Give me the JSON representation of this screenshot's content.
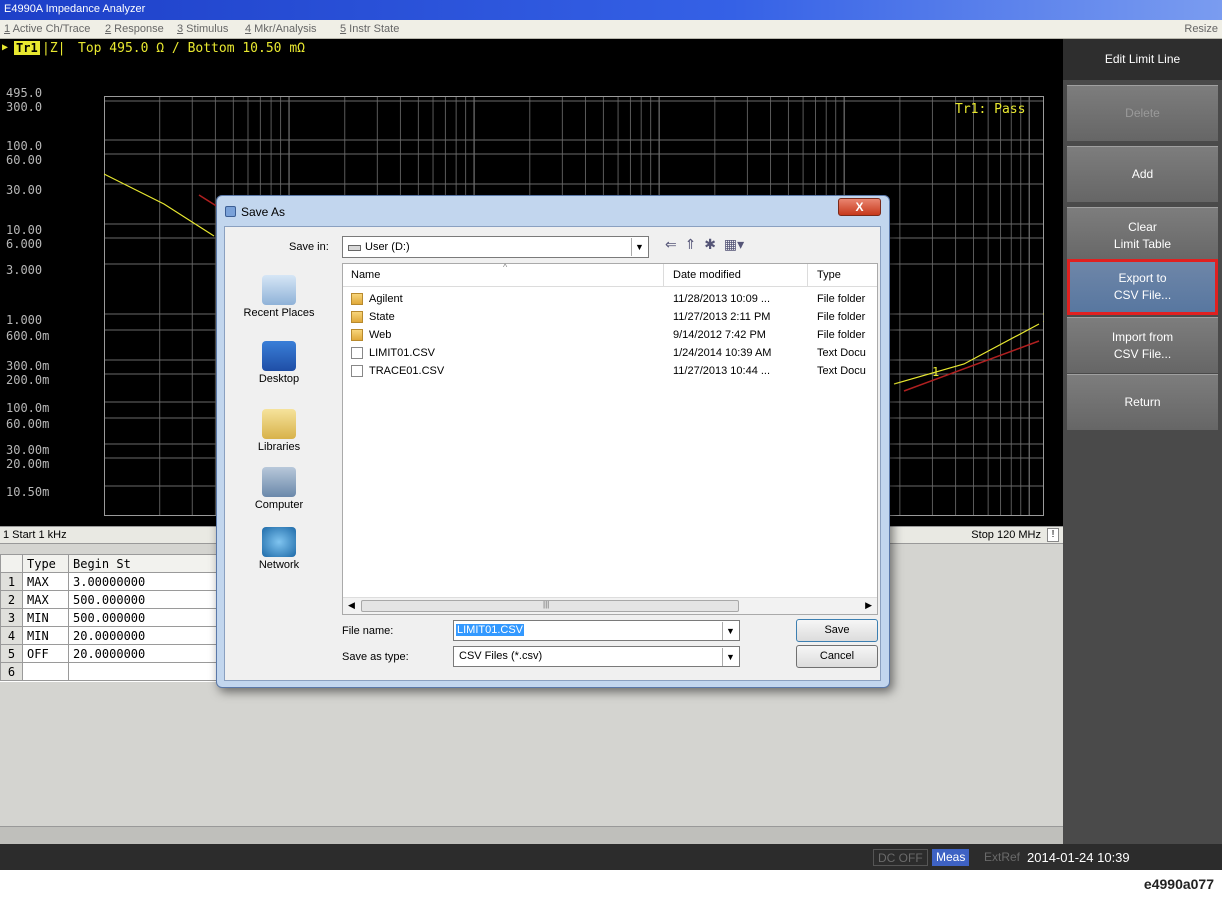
{
  "window": {
    "title": "E4990A Impedance Analyzer"
  },
  "menu": {
    "items": [
      {
        "key": "1",
        "label": " Active Ch/Trace"
      },
      {
        "key": "2",
        "label": " Response"
      },
      {
        "key": "3",
        "label": " Stimulus"
      },
      {
        "key": "4",
        "label": " Mkr/Analysis"
      },
      {
        "key": "5",
        "label": " Instr State"
      }
    ],
    "resize": "Resize"
  },
  "trace": {
    "marker": "▶",
    "name": "Tr1",
    "format": "|Z|",
    "scale": "Top 495.0 Ω / Bottom 10.50 mΩ",
    "status": "Tr1: Pass",
    "marker_label": "1",
    "trace_color": "#e8e830",
    "limit_color": "#b02020",
    "y_labels": [
      "495.0",
      "300.0",
      "100.0",
      "60.00",
      "30.00",
      "10.00",
      "6.000",
      "3.000",
      "1.000",
      "600.0m",
      "300.0m",
      "200.0m",
      "100.0m",
      "60.00m",
      "30.00m",
      "20.00m",
      "10.50m"
    ]
  },
  "freq": {
    "start": "1  Start 1 kHz",
    "stop": "Stop 120 MHz",
    "flag": "!"
  },
  "limit_table": {
    "headers": [
      "",
      "Type",
      "Begin St"
    ],
    "rows": [
      {
        "num": "1",
        "type": "MAX",
        "begin": "3.00000000"
      },
      {
        "num": "2",
        "type": "MAX",
        "begin": "500.000000"
      },
      {
        "num": "3",
        "type": "MIN",
        "begin": "500.000000"
      },
      {
        "num": "4",
        "type": "MIN",
        "begin": "20.0000000"
      },
      {
        "num": "5",
        "type": "OFF",
        "begin": "20.0000000"
      },
      {
        "num": "6",
        "type": "",
        "begin": ""
      }
    ]
  },
  "softkeys": {
    "title": "Edit Limit Line",
    "buttons": [
      {
        "label": "Delete"
      },
      {
        "label": "Add"
      },
      {
        "label": "Clear\nLimit Table"
      },
      {
        "label": "Export to\nCSV File..."
      },
      {
        "label": "Import from\nCSV File..."
      },
      {
        "label": "Return"
      }
    ]
  },
  "status": {
    "dc": "DC OFF",
    "meas": "Meas",
    "ext": "ExtRef",
    "time": "2014-01-24 10:39"
  },
  "figure_id": "e4990a077",
  "dialog": {
    "title": "Save As",
    "close": "X",
    "save_in_label": "Save in:",
    "save_in_value": "User (D:)",
    "places": [
      "Recent Places",
      "Desktop",
      "Libraries",
      "Computer",
      "Network"
    ],
    "columns": [
      "Name",
      "Date modified",
      "Type"
    ],
    "files": [
      {
        "name": "Agilent",
        "date": "11/28/2013 10:09 ...",
        "type": "File folder",
        "kind": "folder"
      },
      {
        "name": "State",
        "date": "11/27/2013 2:11 PM",
        "type": "File folder",
        "kind": "folder"
      },
      {
        "name": "Web",
        "date": "9/14/2012 7:42 PM",
        "type": "File folder",
        "kind": "folder"
      },
      {
        "name": "LIMIT01.CSV",
        "date": "1/24/2014 10:39 AM",
        "type": "Text Docu",
        "kind": "doc"
      },
      {
        "name": "TRACE01.CSV",
        "date": "11/27/2013 10:44 ...",
        "type": "Text Docu",
        "kind": "doc"
      }
    ],
    "file_name_label": "File name:",
    "file_name_value": "LIMIT01.CSV",
    "save_type_label": "Save as type:",
    "save_type_value": "CSV Files (*.csv)",
    "save_button": "Save",
    "cancel_button": "Cancel"
  }
}
